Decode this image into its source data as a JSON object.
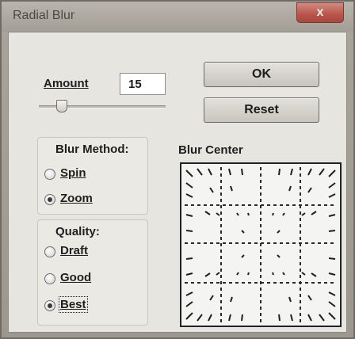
{
  "window": {
    "title": "Radial Blur",
    "close_glyph": "x"
  },
  "amount": {
    "label": "Amount",
    "value": "15",
    "slider_value": 15,
    "slider_max": 100
  },
  "buttons": {
    "ok_label": "OK",
    "reset_label": "Reset"
  },
  "blur_method": {
    "title": "Blur Method:",
    "options": [
      {
        "label": "Spin",
        "checked": false
      },
      {
        "label": "Zoom",
        "checked": true
      }
    ]
  },
  "quality": {
    "title": "Quality:",
    "options": [
      {
        "label": "Draft",
        "checked": false
      },
      {
        "label": "Good",
        "checked": false
      },
      {
        "label": "Best",
        "checked": true
      }
    ]
  },
  "blur_center": {
    "label": "Blur Center"
  },
  "colors": {
    "close_button": "#b9544a",
    "client_background": "#e7e5df",
    "frame": "#a39e96"
  }
}
